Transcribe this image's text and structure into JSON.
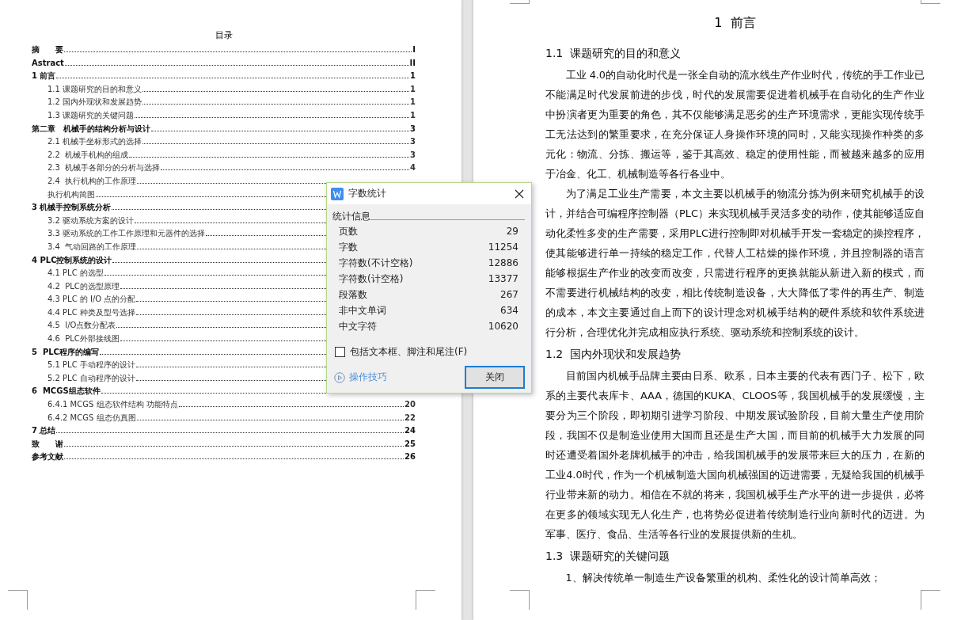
{
  "toc": {
    "title": "目录",
    "entries": [
      {
        "text": "摘　　要",
        "page": "I"
      },
      {
        "text": "Astract",
        "page": "II"
      },
      {
        "text": "1 前言",
        "page": "1",
        "children": [
          {
            "text": "1.1 课题研究的目的和意义",
            "page": "1"
          },
          {
            "text": "1.2 国内外现状和发展趋势",
            "page": "1"
          },
          {
            "text": "1.3 课题研究的关键问题",
            "page": "1"
          }
        ]
      },
      {
        "text": "第二章　机械手的结构分析与设计",
        "page": "3",
        "children": [
          {
            "text": "2.1 机械手坐标形式的选择",
            "page": "3"
          },
          {
            "text": "2.2  机械手机构的组成",
            "page": "3"
          },
          {
            "text": "2.3  机械手各部分的分析与选择",
            "page": "4"
          },
          {
            "text": "2.4  执行机构的工作原理"
          },
          {
            "text": "执行机构简图"
          }
        ]
      },
      {
        "text": "3 机械手控制系统分析",
        "children": [
          {
            "text": "3.2 驱动系统方案的设计"
          },
          {
            "text": "3.3 驱动系统的工作工作原理和元器件的选择"
          },
          {
            "text": "3.4  气动回路的工作原理"
          }
        ]
      },
      {
        "text": "4 PLC控制系统的设计",
        "children": [
          {
            "text": "4.1 PLC 的选型"
          },
          {
            "text": "4.2  PLC的选型原理"
          },
          {
            "text": "4.3 PLC 的 I/O 点的分配"
          },
          {
            "text": "4.4 PLC 种类及型号选择"
          },
          {
            "text": "4.5  I/O点数分配表"
          },
          {
            "text": "4.6  PLC外部接线图"
          }
        ]
      },
      {
        "text": "5  PLC程序的编写",
        "children": [
          {
            "text": "5.1 PLC 手动程序的设计"
          },
          {
            "text": "5.2 PLC 自动程序的设计"
          }
        ]
      },
      {
        "text": "6  MCGS组态软件",
        "children": [
          {
            "text": "6.4.1 MCGS 组态软件结构 功能特点",
            "page": "20"
          },
          {
            "text": "6.4.2 MCGS 组态仿真图",
            "page": "22"
          }
        ]
      },
      {
        "text": "7 总结",
        "page": "24"
      },
      {
        "text": "致　　谢",
        "page": "25"
      },
      {
        "text": "参考文献",
        "page": "26"
      }
    ]
  },
  "document": {
    "blocks": [
      {
        "kind": "title",
        "text": "1  前言"
      },
      {
        "kind": "heading",
        "text": "1.1  课题研究的目的和意义"
      },
      {
        "kind": "paragraph",
        "text": "工业 4.0的自动化时代是一张全自动的流水线生产作业时代，传统的手工作业已不能满足时代发展前进的步伐，时代的发展需要促进着机械手在自动化的生产作业中扮演者更为重要的角色，其不仅能够满足恶劣的生产环境需求，更能实现传统手工无法达到的繁重要求，在充分保证人身操作环境的同时，又能实现操作种类的多元化：物流、分拣、搬运等，鉴于其高效、稳定的使用性能，而被越来越多的应用于冶金、化工、机械制造等各行各业中。"
      },
      {
        "kind": "paragraph",
        "text": "为了满足工业生产需要，本文主要以机械手的物流分拣为例来研究机械手的设计，并结合可编程序控制器（PLC）来实现机械手灵活多变的动作，使其能够适应自动化柔性多变的生产需要，采用PLC进行控制即对机械手开发一套稳定的操控程序，使其能够进行单一持续的稳定工作，代替人工枯燥的操作环境，并且控制器的语言能够根据生产作业的改变而改变，只需进行程序的更换就能从新进入新的模式，而不需要进行机械结构的改变，相比传统制造设备，大大降低了零件的再生产、制造的成本，本文主要通过自上而下的设计理念对机械手结构的硬件系统和软件系统进行分析，合理优化并完成相应执行系统、驱动系统和控制系统的设计。"
      },
      {
        "kind": "heading",
        "text": "1.2  国内外现状和发展趋势"
      },
      {
        "kind": "paragraph",
        "text": "目前国内机械手品牌主要由日系、欧系，日本主要的代表有西门子、松下，欧系的主要代表库卡、AAA，德国的KUKA、CLOOS等，我国机械手的发展缓慢，主要分为三个阶段，即初期引进学习阶段、中期发展试验阶段，目前大量生产使用阶段，我国不仅是制造业使用大国而且还是生产大国，而目前的机械手大力发展的同时还遭受着国外老牌机械手的冲击，给我国机械手的发展带来巨大的压力，在新的工业4.0时代，作为一个机械制造大国向机械强国的迈进需要，无疑给我国的机械手行业带来新的动力。相信在不就的将来，我国机械手生产水平的进一步提供，必将在更多的领域实现无人化生产，也将势必促进着传统制造行业向新时代的迈进。为军事、医疗、食品、生活等各行业的发展提供新的生机。"
      },
      {
        "kind": "heading",
        "text": "1.3  课题研究的关键问题"
      },
      {
        "kind": "paragraph",
        "text": "1、解决传统单一制造生产设备繁重的机构、柔性化的设计简单高效；"
      }
    ]
  },
  "dialog": {
    "title": "字数统计",
    "section": "统计信息",
    "stats": [
      {
        "label": "页数",
        "value": "29"
      },
      {
        "label": "字数",
        "value": "11254"
      },
      {
        "label": "字符数(不计空格)",
        "value": "12886"
      },
      {
        "label": "字符数(计空格)",
        "value": "13377"
      },
      {
        "label": "段落数",
        "value": "267"
      },
      {
        "label": "非中文单词",
        "value": "634"
      },
      {
        "label": "中文字符",
        "value": "10620"
      }
    ],
    "option": {
      "label": "包括文本框、脚注和尾注(F)",
      "checked": false
    },
    "tips_link": "操作技巧",
    "button": "关闭"
  }
}
